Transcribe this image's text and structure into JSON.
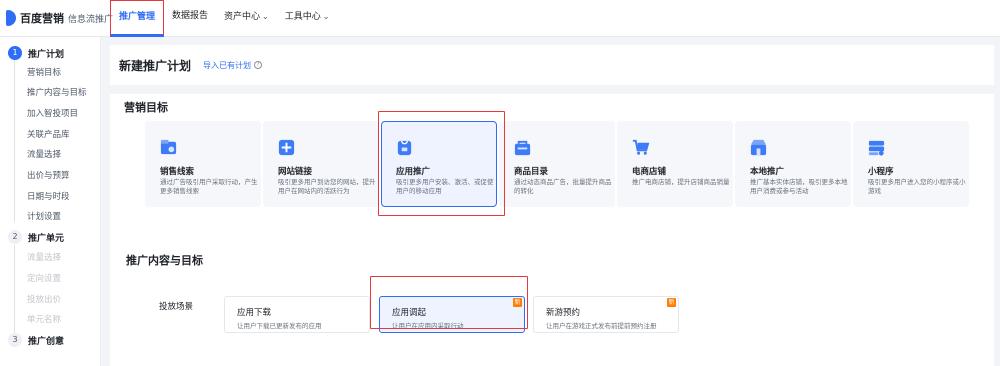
{
  "brand": {
    "name": "百度营销",
    "product": "信息流推广"
  },
  "nav": {
    "items": [
      {
        "label": "推广管理",
        "active": true,
        "dropdown": false
      },
      {
        "label": "数据报告",
        "dropdown": false
      },
      {
        "label": "资产中心",
        "dropdown": true
      },
      {
        "label": "工具中心",
        "dropdown": true
      }
    ]
  },
  "sidebar": {
    "steps": [
      {
        "num": "1",
        "label": "推广计划",
        "active": true,
        "items": [
          "营销目标",
          "推广内容与目标",
          "加入智投项目",
          "关联产品库",
          "流量选择",
          "出价与预算",
          "日期与时段",
          "计划设置"
        ]
      },
      {
        "num": "2",
        "label": "推广单元",
        "items": [
          "流量选择",
          "定向设置",
          "投放出价",
          "单元名称"
        ]
      },
      {
        "num": "3",
        "label": "推广创意",
        "items": []
      }
    ]
  },
  "plan": {
    "title": "新建推广计划",
    "import_link": "导入已有计划",
    "help_icon": "?"
  },
  "target": {
    "title": "营销目标",
    "goals": [
      {
        "title": "销售线索",
        "desc": "通过广告吸引用户采取行动，产生更多销售线索",
        "icon": "lead-icon",
        "color": "#3d7bf7"
      },
      {
        "title": "网站链接",
        "desc": "吸引更多用户到访您的网站，提升用户在网站内的活跃行为",
        "icon": "link-icon",
        "color": "#3d7bf7"
      },
      {
        "title": "应用推广",
        "desc": "吸引更多用户安装、激活、或促使用户的移动应用",
        "icon": "app-icon",
        "color": "#3d7bf7",
        "selected": true
      },
      {
        "title": "商品目录",
        "desc": "通过动态商品广告，批量提升商品的转化",
        "icon": "catalog-icon",
        "color": "#3d7bf7"
      },
      {
        "title": "电商店铺",
        "desc": "推广电商店铺，提升店铺商品销量",
        "icon": "shop-icon",
        "color": "#3d7bf7"
      },
      {
        "title": "本地推广",
        "desc": "推广基本实体店铺，吸引更多本地用户消费或参与活动",
        "icon": "local-icon",
        "color": "#3d7bf7"
      },
      {
        "title": "小程序",
        "desc": "吸引更多用户进入您的小程序或小游戏",
        "icon": "miniprogram-icon",
        "color": "#3d7bf7"
      }
    ]
  },
  "content": {
    "title": "推广内容与目标",
    "scene_label": "投放场景",
    "scenes": [
      {
        "title": "应用下载",
        "desc": "让用户下载已更新发布的应用",
        "badge": ""
      },
      {
        "title": "应用调起",
        "desc": "让用户在应用内采取行动",
        "badge": "新",
        "selected": true
      },
      {
        "title": "新游预约",
        "desc": "让用户在游戏正式发布前提前预约注册",
        "badge": "新"
      }
    ]
  },
  "colors": {
    "accent": "#2f6df6",
    "highlight": "#e5393d",
    "badge": "#ff7d00"
  }
}
